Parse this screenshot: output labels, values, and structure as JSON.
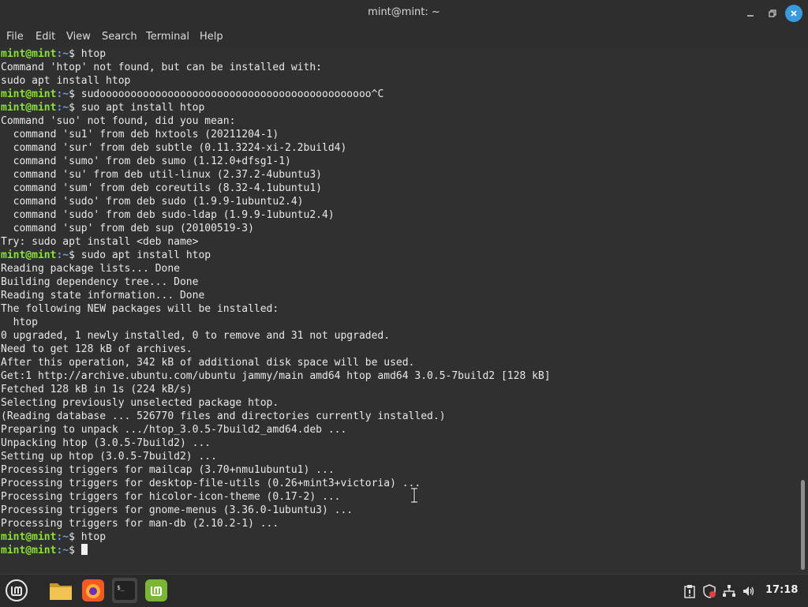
{
  "window": {
    "title": "mint@mint: ~"
  },
  "menu": {
    "items": [
      "File",
      "Edit",
      "View",
      "Search",
      "Terminal",
      "Help"
    ]
  },
  "terminal": {
    "lines": [
      {
        "user": "mint@mint",
        "path": ":~",
        "cmd": "$ htop"
      },
      {
        "text": "Command 'htop' not found, but can be installed with:"
      },
      {
        "text": "sudo apt install htop"
      },
      {
        "user": "mint@mint",
        "path": ":~",
        "cmd": "$ sudoooooooooooooooooooooooooooooooooooooooooooo^C"
      },
      {
        "user": "mint@mint",
        "path": ":~",
        "cmd": "$ suo apt install htop"
      },
      {
        "text": "Command 'suo' not found, did you mean:"
      },
      {
        "text": "  command 'su1' from deb hxtools (20211204-1)"
      },
      {
        "text": "  command 'sur' from deb subtle (0.11.3224-xi-2.2build4)"
      },
      {
        "text": "  command 'sumo' from deb sumo (1.12.0+dfsg1-1)"
      },
      {
        "text": "  command 'su' from deb util-linux (2.37.2-4ubuntu3)"
      },
      {
        "text": "  command 'sum' from deb coreutils (8.32-4.1ubuntu1)"
      },
      {
        "text": "  command 'sudo' from deb sudo (1.9.9-1ubuntu2.4)"
      },
      {
        "text": "  command 'sudo' from deb sudo-ldap (1.9.9-1ubuntu2.4)"
      },
      {
        "text": "  command 'sup' from deb sup (20100519-3)"
      },
      {
        "text": "Try: sudo apt install <deb name>"
      },
      {
        "user": "mint@mint",
        "path": ":~",
        "cmd": "$ sudo apt install htop"
      },
      {
        "text": "Reading package lists... Done"
      },
      {
        "text": "Building dependency tree... Done"
      },
      {
        "text": "Reading state information... Done"
      },
      {
        "text": "The following NEW packages will be installed:"
      },
      {
        "text": "  htop"
      },
      {
        "text": "0 upgraded, 1 newly installed, 0 to remove and 31 not upgraded."
      },
      {
        "text": "Need to get 128 kB of archives."
      },
      {
        "text": "After this operation, 342 kB of additional disk space will be used."
      },
      {
        "text": "Get:1 http://archive.ubuntu.com/ubuntu jammy/main amd64 htop amd64 3.0.5-7build2 [128 kB]"
      },
      {
        "text": "Fetched 128 kB in 1s (224 kB/s)"
      },
      {
        "text": "Selecting previously unselected package htop."
      },
      {
        "text": "(Reading database ... 526770 files and directories currently installed.)"
      },
      {
        "text": "Preparing to unpack .../htop_3.0.5-7build2_amd64.deb ..."
      },
      {
        "text": "Unpacking htop (3.0.5-7build2) ..."
      },
      {
        "text": "Setting up htop (3.0.5-7build2) ..."
      },
      {
        "text": "Processing triggers for mailcap (3.70+nmu1ubuntu1) ..."
      },
      {
        "text": "Processing triggers for desktop-file-utils (0.26+mint3+victoria) ..."
      },
      {
        "text": "Processing triggers for hicolor-icon-theme (0.17-2) ..."
      },
      {
        "text": "Processing triggers for gnome-menus (3.36.0-1ubuntu3) ..."
      },
      {
        "text": "Processing triggers for man-db (2.10.2-1) ..."
      },
      {
        "user": "mint@mint",
        "path": ":~",
        "cmd": "$ htop"
      },
      {
        "user": "mint@mint",
        "path": ":~",
        "cmd": "$ ",
        "cursor": true
      }
    ]
  },
  "taskbar": {
    "apps": [
      "menu-icon",
      "folder-icon",
      "firefox-icon",
      "terminal-icon",
      "mintupdate-icon"
    ],
    "tray": [
      "clipboard-icon",
      "shield-icon",
      "network-icon",
      "volume-icon"
    ],
    "clock": "17:18"
  },
  "colors": {
    "prompt_user": "#8ae234",
    "prompt_path": "#729fcf",
    "accent": "#3a9bdc"
  }
}
